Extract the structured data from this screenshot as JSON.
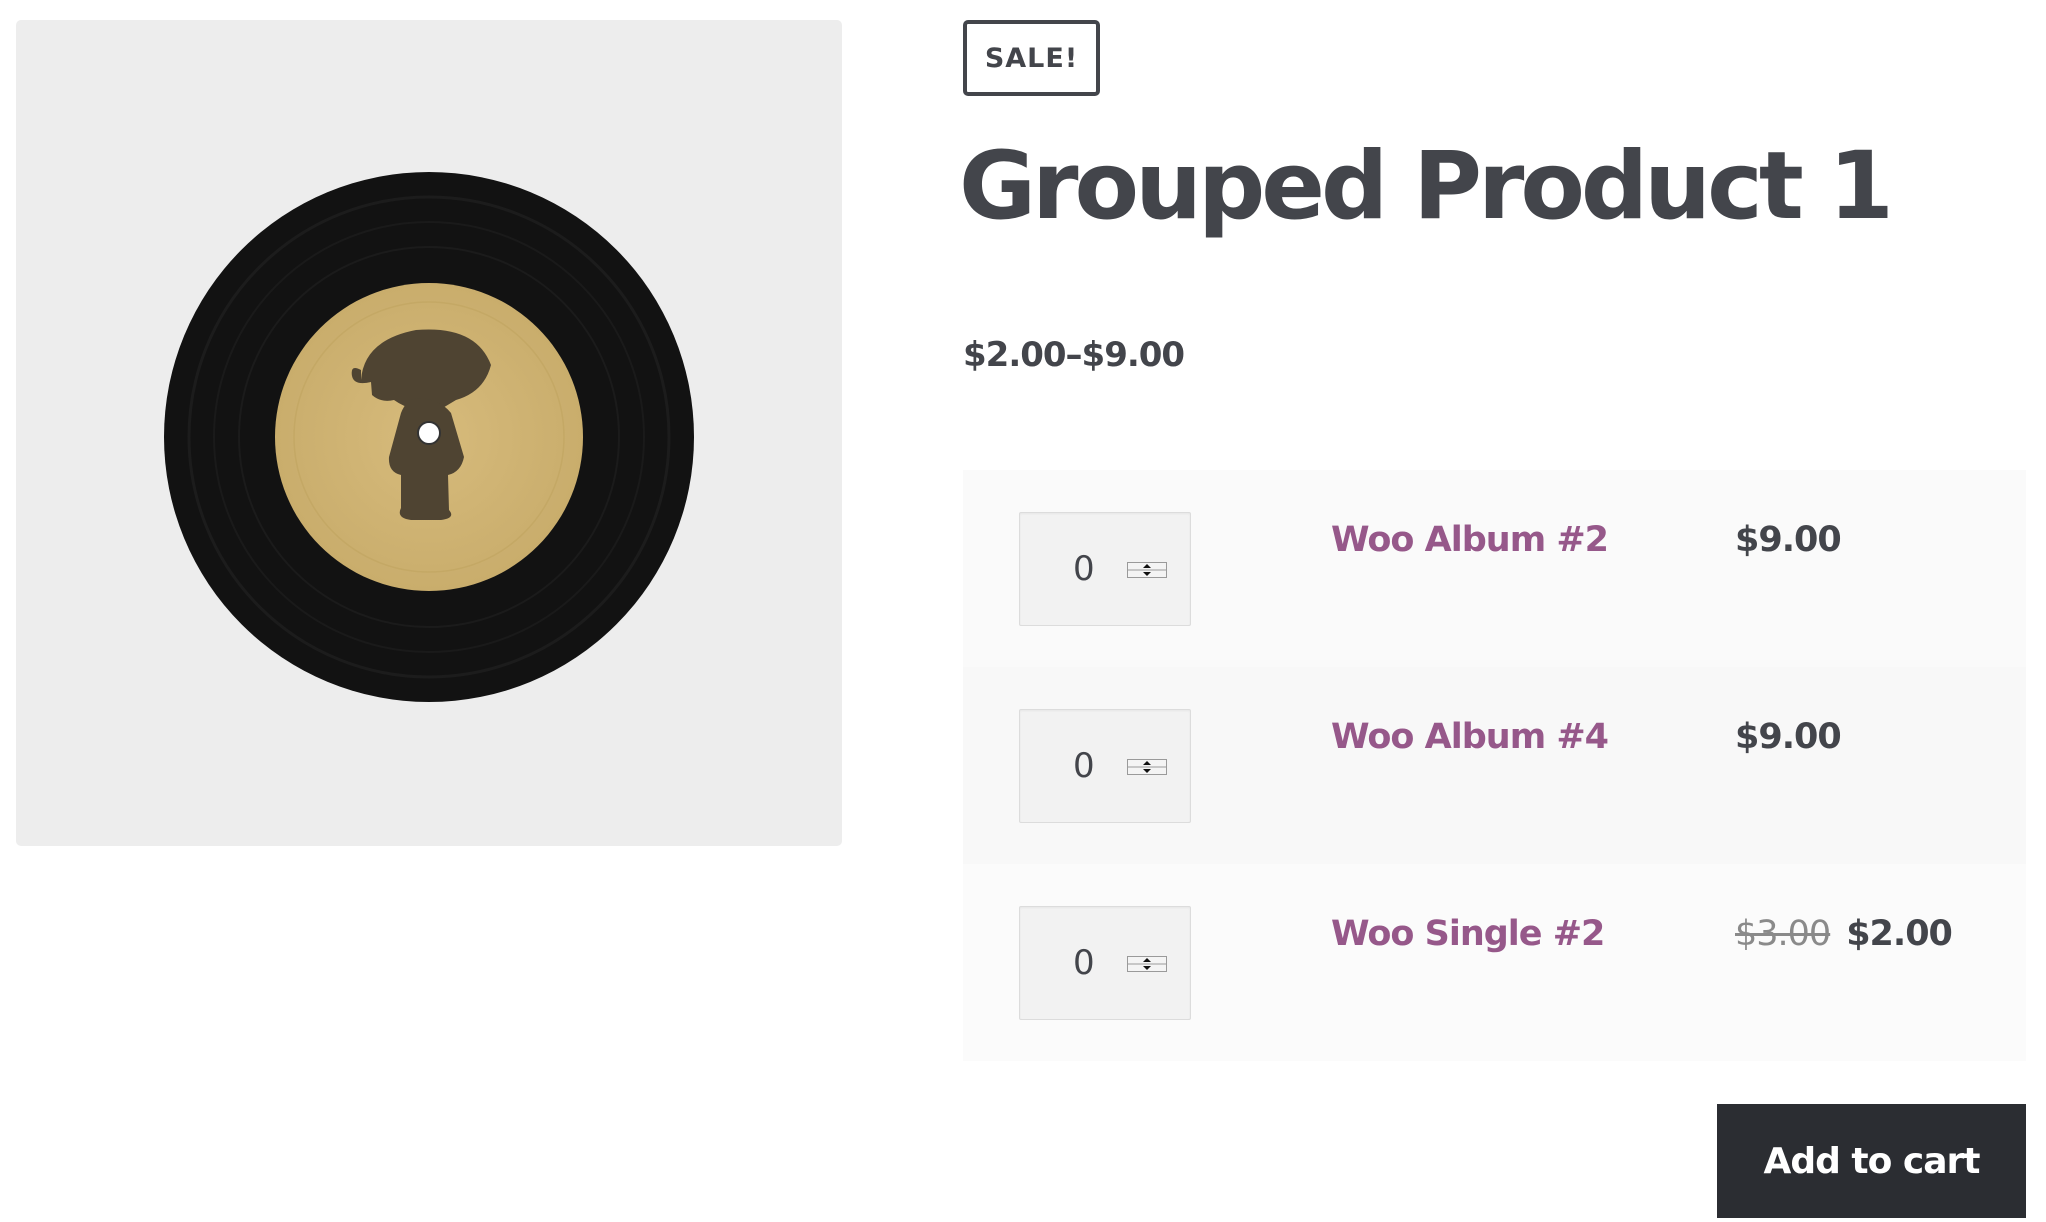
{
  "product": {
    "badge": "SALE!",
    "title": "Grouped Product 1",
    "price_range": "$2.00–$9.00",
    "image_icon": "vinyl-record-image"
  },
  "grouped_items": [
    {
      "quantity": "0",
      "name": "Woo Album #2",
      "price": "$9.00",
      "old_price": ""
    },
    {
      "quantity": "0",
      "name": "Woo Album #4",
      "price": "$9.00",
      "old_price": ""
    },
    {
      "quantity": "0",
      "name": "Woo Single #2",
      "price": "$2.00",
      "old_price": "$3.00"
    }
  ],
  "add_to_cart_label": "Add to cart",
  "colors": {
    "text": "#43454b",
    "link": "#96588a",
    "button_bg": "#2b2d32",
    "image_bg": "#ededed",
    "record_label": "#d0b373"
  }
}
